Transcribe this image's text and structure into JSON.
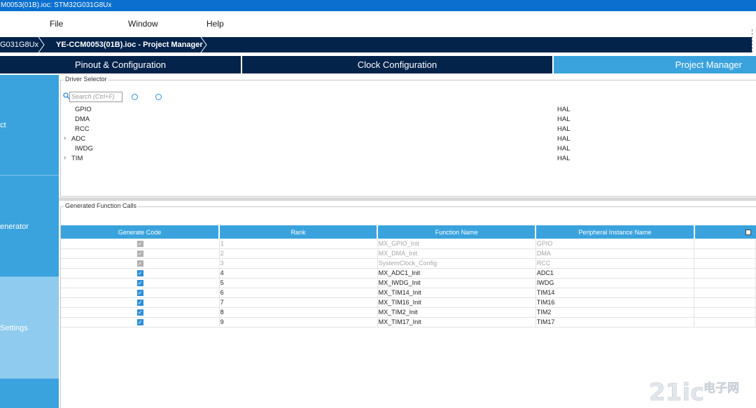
{
  "window": {
    "title": "M0053(01B).ioc: STM32G031G8Ux"
  },
  "menu": [
    {
      "label": "File"
    },
    {
      "label": "Window"
    },
    {
      "label": "Help"
    }
  ],
  "breadcrumb": [
    {
      "label": "G031G8Ux"
    },
    {
      "label": "YE-CCM0053(01B).ioc - Project Manager"
    }
  ],
  "tabs": [
    {
      "label": "Pinout & Configuration",
      "active": false
    },
    {
      "label": "Clock Configuration",
      "active": false
    },
    {
      "label": "Project Manager",
      "active": true
    }
  ],
  "sidebar": {
    "items": [
      {
        "label": "ct"
      },
      {
        "label": "enerator"
      },
      {
        "label": "Settings",
        "selected": true
      }
    ]
  },
  "driver_selector": {
    "title": "Driver Selector",
    "search_placeholder": "Search (Ctrl+F)",
    "rows": [
      {
        "name": "GPIO",
        "driver": "HAL",
        "expandable": false
      },
      {
        "name": "DMA",
        "driver": "HAL",
        "expandable": false
      },
      {
        "name": "RCC",
        "driver": "HAL",
        "expandable": false
      },
      {
        "name": "ADC",
        "driver": "HAL",
        "expandable": true
      },
      {
        "name": "IWDG",
        "driver": "HAL",
        "expandable": false
      },
      {
        "name": "TIM",
        "driver": "HAL",
        "expandable": true
      }
    ]
  },
  "function_calls": {
    "title": "Generated Function Calls",
    "columns": [
      "Generate Code",
      "Rank",
      "Function Name",
      "Peripheral Instance Name"
    ],
    "rows": [
      {
        "rank": "1",
        "function": "MX_GPIO_Init",
        "instance": "GPIO",
        "checked": true,
        "disabled": true
      },
      {
        "rank": "2",
        "function": "MX_DMA_Init",
        "instance": "DMA",
        "checked": true,
        "disabled": true
      },
      {
        "rank": "3",
        "function": "SystemClock_Config",
        "instance": "RCC",
        "checked": true,
        "disabled": true
      },
      {
        "rank": "4",
        "function": "MX_ADC1_Init",
        "instance": "ADC1",
        "checked": true,
        "disabled": false
      },
      {
        "rank": "5",
        "function": "MX_IWDG_Init",
        "instance": "IWDG",
        "checked": true,
        "disabled": false
      },
      {
        "rank": "6",
        "function": "MX_TIM14_Init",
        "instance": "TIM14",
        "checked": true,
        "disabled": false
      },
      {
        "rank": "7",
        "function": "MX_TIM16_Init",
        "instance": "TIM16",
        "checked": true,
        "disabled": false
      },
      {
        "rank": "8",
        "function": "MX_TIM2_Init",
        "instance": "TIM2",
        "checked": true,
        "disabled": false
      },
      {
        "rank": "9",
        "function": "MX_TIM17_Init",
        "instance": "TIM17",
        "checked": true,
        "disabled": false
      }
    ]
  },
  "watermark": {
    "text": "21ic电子网"
  },
  "colors": {
    "accent": "#3aa3dd",
    "navy": "#03234b",
    "titlebar": "#0a6fce",
    "checkbox": "#2d8fd8"
  }
}
